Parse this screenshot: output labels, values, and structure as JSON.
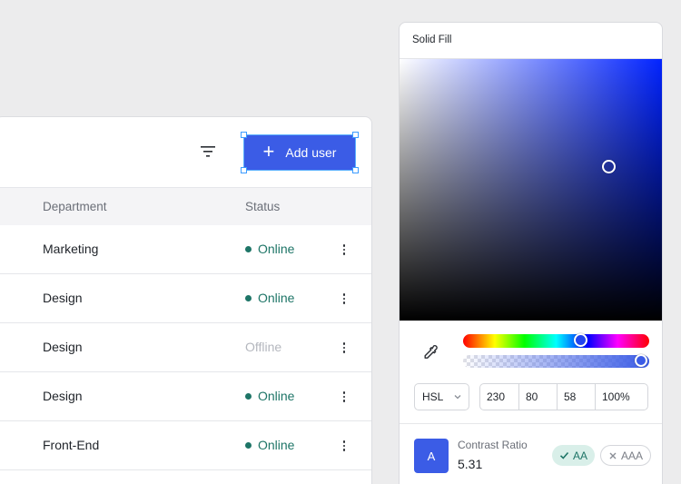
{
  "users_card": {
    "add_button_label": "Add user",
    "columns": {
      "department": "Department",
      "status": "Status"
    },
    "rows": [
      {
        "department": "Marketing",
        "status": "Online"
      },
      {
        "department": "Design",
        "status": "Online"
      },
      {
        "department": "Design",
        "status": "Offline"
      },
      {
        "department": "Design",
        "status": "Online"
      },
      {
        "department": "Front-End",
        "status": "Online"
      }
    ]
  },
  "color_picker": {
    "title": "Solid Fill",
    "mode": "HSL",
    "values": [
      "230",
      "80",
      "58",
      "100%"
    ],
    "swatch_letter": "A",
    "contrast_label": "Contrast Ratio",
    "contrast_value": "5.31",
    "badge_pass": "AA",
    "badge_fail": "AAA",
    "color": "#3b5ce6"
  },
  "colors": {
    "accent": "#3b5ce6",
    "online": "#1e7567",
    "offline": "#b4b7be"
  },
  "icons": [
    "filter-icon",
    "plus-icon",
    "more-vertical-icon",
    "eyedropper-icon",
    "chevron-down-icon",
    "check-icon",
    "x-icon"
  ]
}
